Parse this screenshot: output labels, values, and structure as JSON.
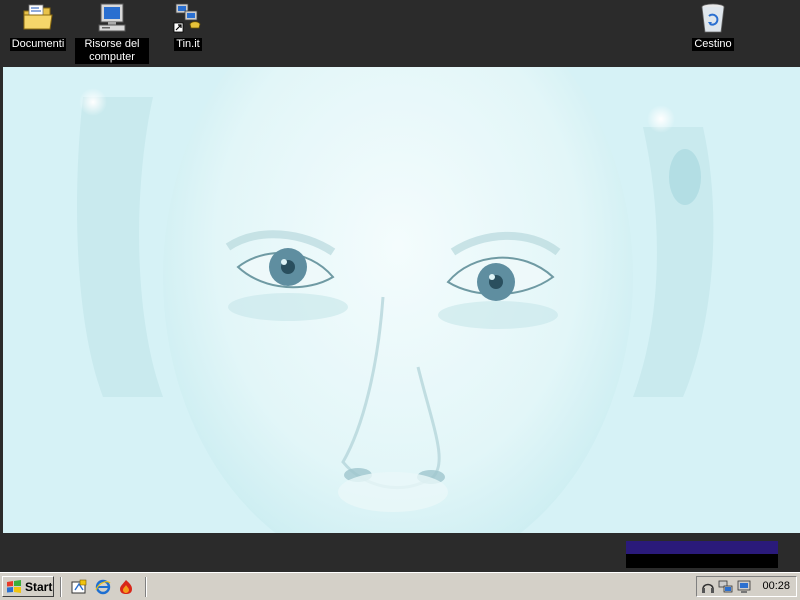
{
  "desktop_icons": [
    {
      "label": "Documenti",
      "icon": "folder-documents-icon"
    },
    {
      "label": "Risorse del computer",
      "icon": "my-computer-icon"
    },
    {
      "label": "Tin.it",
      "icon": "network-connection-shortcut-icon"
    },
    {
      "label": "Cestino",
      "icon": "recycle-bin-icon"
    }
  ],
  "taskbar": {
    "start_label": "Start",
    "quick_launch": [
      "show-desktop-icon",
      "internet-explorer-icon",
      "firewall-icon"
    ],
    "tray_icons": [
      "headphones-icon",
      "network-icon",
      "monitor-icon"
    ],
    "clock": "00:28"
  },
  "colors": {
    "desktop_bg": "#2b2b2b",
    "taskbar_bg": "#d4d0c8",
    "wallpaper_tint": "#d4f1f6"
  }
}
